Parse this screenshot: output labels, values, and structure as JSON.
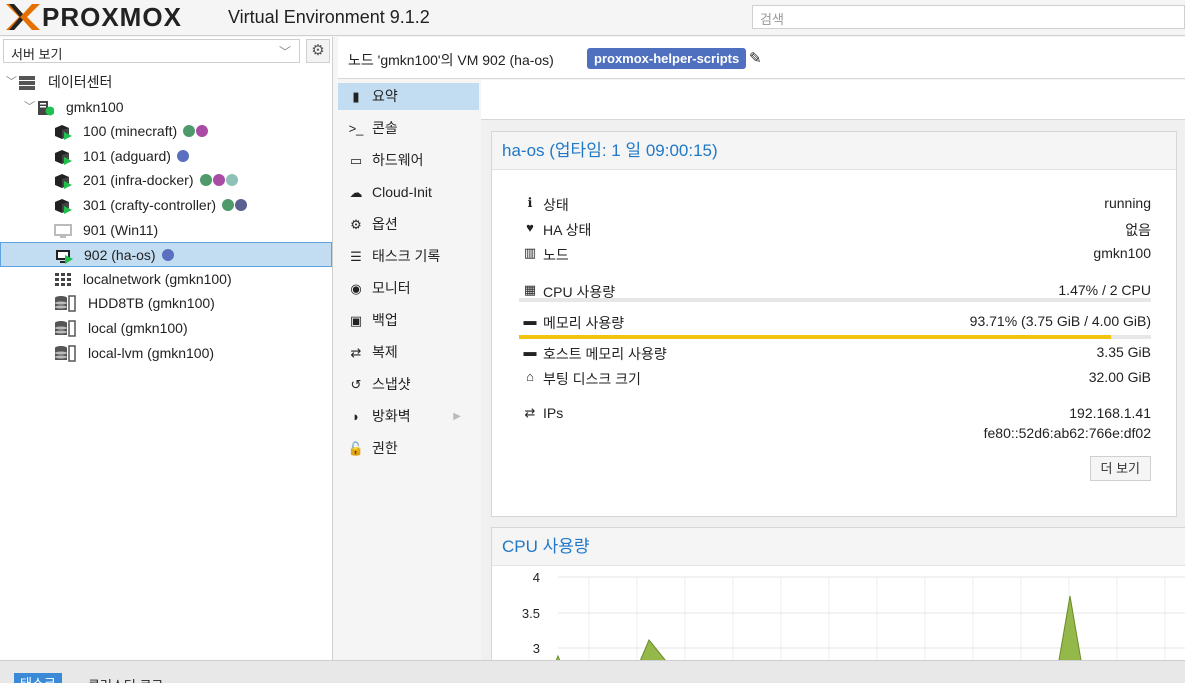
{
  "app": {
    "brand": "PROXMOX",
    "version_text": "Virtual Environment 9.1.2",
    "search_placeholder": "검색"
  },
  "tree": {
    "view_label": "서버 보기",
    "items": [
      {
        "label": "데이터센터",
        "level": 0,
        "icon": "server-rack-icon"
      },
      {
        "label": "gmkn100",
        "level": 1,
        "icon": "node-icon"
      },
      {
        "label": "100 (minecraft)",
        "level": 2,
        "icon": "running-container-icon",
        "tags": [
          "#4e9a6b",
          "#a94aa5"
        ]
      },
      {
        "label": "101 (adguard)",
        "level": 2,
        "icon": "running-container-icon",
        "tags": [
          "#5a6fbf"
        ]
      },
      {
        "label": "201 (infra-docker)",
        "level": 2,
        "icon": "running-container-icon",
        "tags": [
          "#4e9a6b",
          "#a94aa5",
          "#8fc0b8"
        ]
      },
      {
        "label": "301 (crafty-controller)",
        "level": 2,
        "icon": "running-container-icon",
        "tags": [
          "#4e9a6b",
          "#5a6090"
        ]
      },
      {
        "label": "901 (Win11)",
        "level": 2,
        "icon": "stopped-vm-icon",
        "tags": []
      },
      {
        "label": "902 (ha-os)",
        "level": 2,
        "icon": "running-vm-icon",
        "tags": [
          "#5a6fbf"
        ],
        "selected": true
      },
      {
        "label": "localnetwork (gmkn100)",
        "level": 2,
        "icon": "network-grid-icon",
        "tags": []
      },
      {
        "label": "HDD8TB (gmkn100)",
        "level": 2,
        "icon": "storage-icon",
        "tags": []
      },
      {
        "label": "local (gmkn100)",
        "level": 2,
        "icon": "storage-icon",
        "tags": []
      },
      {
        "label": "local-lvm (gmkn100)",
        "level": 2,
        "icon": "storage-icon",
        "tags": []
      }
    ]
  },
  "header": {
    "breadcrumb": "노드 'gmkn100'의 VM 902 (ha-os)",
    "tag": "proxmox-helper-scripts"
  },
  "nav": {
    "items": [
      {
        "label": "요약",
        "icon": "book-icon",
        "glyph": "▮",
        "active": true
      },
      {
        "label": "콘솔",
        "icon": "terminal-icon",
        "glyph": ">_"
      },
      {
        "label": "하드웨어",
        "icon": "monitor-icon",
        "glyph": "▭"
      },
      {
        "label": "Cloud-Init",
        "icon": "cloud-icon",
        "glyph": "☁"
      },
      {
        "label": "옵션",
        "icon": "gear-icon",
        "glyph": "⚙"
      },
      {
        "label": "태스크 기록",
        "icon": "list-icon",
        "glyph": "☰"
      },
      {
        "label": "모니터",
        "icon": "eye-icon",
        "glyph": "◉"
      },
      {
        "label": "백업",
        "icon": "floppy-icon",
        "glyph": "▣"
      },
      {
        "label": "복제",
        "icon": "retweet-icon",
        "glyph": "⇄"
      },
      {
        "label": "스냅샷",
        "icon": "history-icon",
        "glyph": "↺"
      },
      {
        "label": "방화벽",
        "icon": "shield-icon",
        "glyph": "◗",
        "has_submenu": true
      },
      {
        "label": "권한",
        "icon": "unlock-icon",
        "glyph": "🔓"
      }
    ]
  },
  "summary": {
    "title": "ha-os (업타임: 1 일 09:00:15)",
    "rows": {
      "status_label": "상태",
      "status_value": "running",
      "ha_label": "HA 상태",
      "ha_value": "없음",
      "node_label": "노드",
      "node_value": "gmkn100",
      "cpu_label": "CPU 사용량",
      "cpu_value": "1.47% / 2 CPU",
      "mem_label": "메모리 사용량",
      "mem_value": "93.71% (3.75 GiB / 4.00 GiB)",
      "mem_fraction": 0.9371,
      "host_mem_label": "호스트 메모리 사용량",
      "host_mem_value": "3.35 GiB",
      "disk_label": "부팅 디스크 크기",
      "disk_value": "32.00 GiB",
      "ips_label": "IPs",
      "ip1": "192.168.1.41",
      "ip2": "fe80::52d6:ab62:766e:df02"
    },
    "more_label": "더 보기"
  },
  "cpu_chart": {
    "title": "CPU 사용량",
    "yticks": [
      "4",
      "3.5",
      "3"
    ]
  },
  "colors": {
    "accent": "#1f78c8",
    "selected_bg": "#c2ddf2",
    "memory_bar": "#f1c40f",
    "tag_pill": "#4f6fbf",
    "running_green": "#21bf4b",
    "chart_fill": "#94b84a"
  },
  "bottom": {
    "tabs": [
      "태스크",
      "클러스터 로그"
    ]
  }
}
